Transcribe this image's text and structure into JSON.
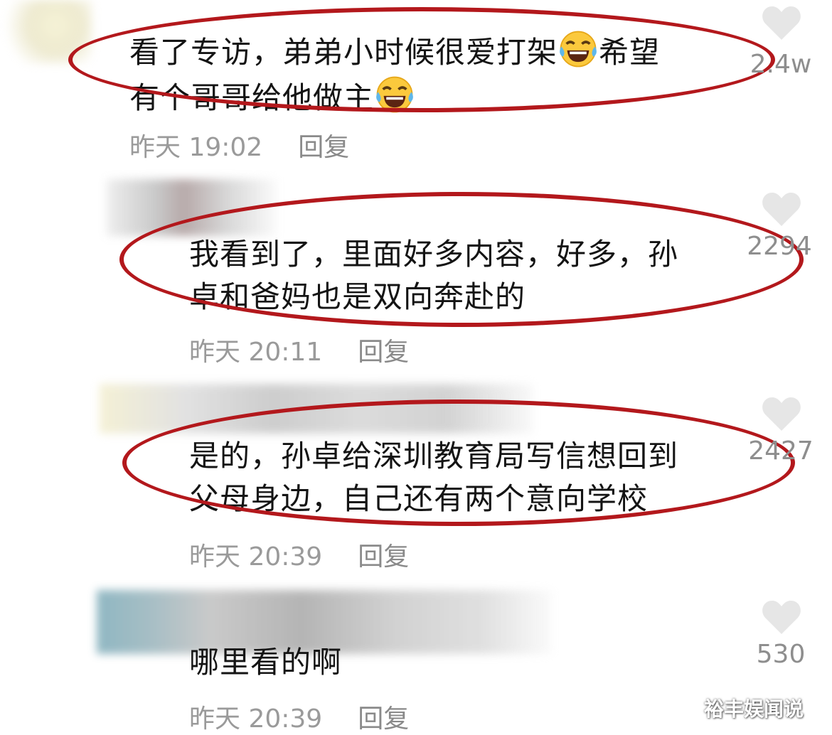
{
  "comments": [
    {
      "text_parts": [
        "看了专访，弟弟小时候很爱打架",
        "希望",
        "有个哥哥给他做主"
      ],
      "emoji": "laughing-tears-emoji",
      "time": "昨天 19:02",
      "reply": "回复",
      "likes": "2.4w"
    },
    {
      "text": "我看到了，里面好多内容，好多，孙卓和爸妈也是双向奔赴的",
      "line1": "我看到了，里面好多内容，好多，孙",
      "line2": "卓和爸妈也是双向奔赴的",
      "time": "昨天 20:11",
      "reply": "回复",
      "likes": "2294"
    },
    {
      "line1": "是的，孙卓给深圳教育局写信想回到",
      "line2": "父母身边，自己还有两个意向学校",
      "time": "昨天 20:39",
      "reply": "回复",
      "likes": "2427"
    },
    {
      "line1": "哪里看的啊",
      "time": "昨天 20:39",
      "reply": "回复",
      "likes": "530"
    }
  ],
  "watermark": "裕丰娱闻说",
  "colors": {
    "highlight_ring": "#b3181c",
    "meta_text": "#9a9a9a",
    "heart": "#e6e6e6"
  },
  "icons": {
    "like": "heart-icon",
    "avatar": "blurred-avatar"
  }
}
